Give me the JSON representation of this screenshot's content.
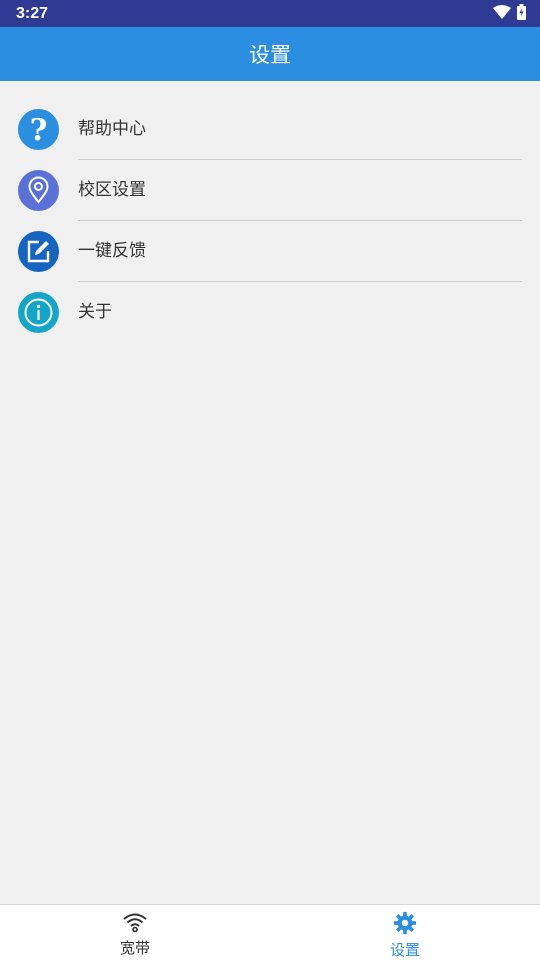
{
  "status_bar": {
    "time": "3:27",
    "icons": [
      "wifi-icon",
      "battery-charging-icon"
    ]
  },
  "header": {
    "title": "设置"
  },
  "menu": {
    "items": [
      {
        "label": "帮助中心",
        "icon": "help-icon",
        "icon_color": "#2b8ee0"
      },
      {
        "label": "校区设置",
        "icon": "location-pin-icon",
        "icon_color": "#5a72d8"
      },
      {
        "label": "一键反馈",
        "icon": "edit-icon",
        "icon_color": "#1565c0"
      },
      {
        "label": "关于",
        "icon": "info-icon",
        "icon_color": "#13a6c9"
      }
    ]
  },
  "bottom_nav": {
    "tabs": [
      {
        "label": "宽带",
        "icon": "wifi-icon",
        "active": false
      },
      {
        "label": "设置",
        "icon": "gear-icon",
        "active": true
      }
    ],
    "active_color": "#2b8ee0",
    "inactive_color": "#333333"
  }
}
